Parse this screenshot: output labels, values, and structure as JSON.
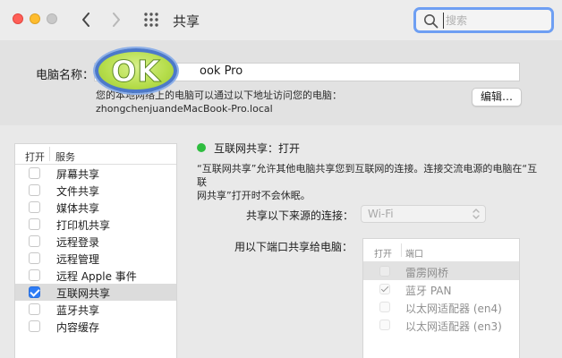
{
  "window": {
    "title": "共享",
    "search_placeholder": "搜索"
  },
  "computer": {
    "name_label": "电脑名称：",
    "name_value": "ook Pro",
    "description": "您的本地网络上的电脑可以通过以下地址访问您的电脑：",
    "hostname": "zhongchenjuandeMacBook-Pro.local",
    "edit_label": "编辑…",
    "watermark_text": "OK"
  },
  "services": {
    "header_on": "打开",
    "header_service": "服务",
    "items": [
      {
        "label": "屏幕共享",
        "checked": false
      },
      {
        "label": "文件共享",
        "checked": false
      },
      {
        "label": "媒体共享",
        "checked": false
      },
      {
        "label": "打印机共享",
        "checked": false
      },
      {
        "label": "远程登录",
        "checked": false
      },
      {
        "label": "远程管理",
        "checked": false
      },
      {
        "label": "远程 Apple 事件",
        "checked": false
      },
      {
        "label": "互联网共享",
        "checked": true,
        "selected": true
      },
      {
        "label": "蓝牙共享",
        "checked": false
      },
      {
        "label": "内容缓存",
        "checked": false
      }
    ]
  },
  "detail": {
    "status": "互联网共享：打开",
    "status_color": "#2ebd3f",
    "description_line1": "“互联网共享”允许其他电脑共享您到互联网的连接。连接交流电源的电脑在“互联",
    "description_line2": "网共享”打开时不会休眠。",
    "source_label": "共享以下来源的连接：",
    "source_value": "Wi-Fi",
    "ports_label": "用以下端口共享给电脑：",
    "ports_header_on": "打开",
    "ports_header_port": "端口",
    "ports": [
      {
        "label": "雷雳网桥",
        "checked": false,
        "selected": true
      },
      {
        "label": "蓝牙 PAN",
        "checked": true
      },
      {
        "label": "以太网适配器 (en4)",
        "checked": false
      },
      {
        "label": "以太网适配器 (en3)",
        "checked": false
      }
    ]
  },
  "colors": {
    "accent": "#2d7cf6",
    "search_focus": "#6e9ff3",
    "close": "#ff5f57",
    "minimize": "#febc2e"
  }
}
